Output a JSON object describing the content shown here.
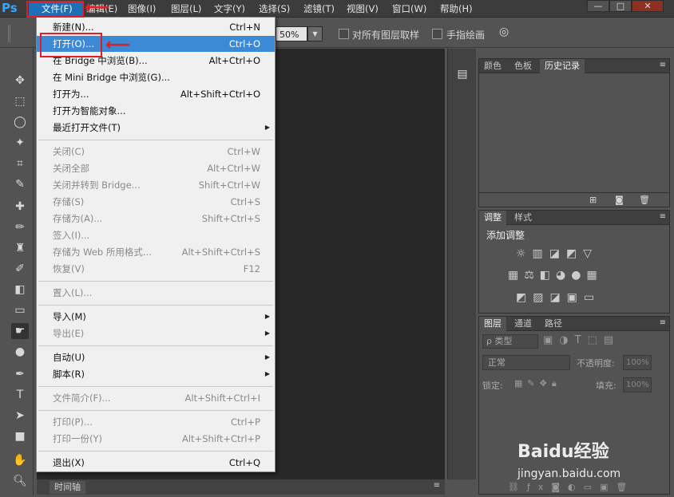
{
  "app": {
    "logo": "Ps"
  },
  "menubar": {
    "items": [
      "文件(F)",
      "编辑(E)",
      "图像(I)",
      "图层(L)",
      "文字(Y)",
      "选择(S)",
      "滤镜(T)",
      "视图(V)",
      "窗口(W)",
      "帮助(H)"
    ]
  },
  "window_controls": {
    "minimize": "—",
    "maximize": "□",
    "close": "✕"
  },
  "options": {
    "zoom": "50%",
    "sample_all_label": "对所有图层取样",
    "finger_paint_label": "手指绘画"
  },
  "file_menu": {
    "items": [
      {
        "label": "新建(N)...",
        "shortcut": "Ctrl+N",
        "enabled": true
      },
      {
        "label": "打开(O)...",
        "shortcut": "Ctrl+O",
        "enabled": true,
        "highlighted": true
      },
      {
        "label": "在 Bridge 中浏览(B)...",
        "shortcut": "Alt+Ctrl+O",
        "enabled": true
      },
      {
        "label": "在 Mini Bridge 中浏览(G)...",
        "shortcut": "",
        "enabled": true
      },
      {
        "label": "打开为...",
        "shortcut": "Alt+Shift+Ctrl+O",
        "enabled": true
      },
      {
        "label": "打开为智能对象...",
        "shortcut": "",
        "enabled": true
      },
      {
        "label": "最近打开文件(T)",
        "shortcut": "",
        "enabled": true,
        "submenu": true
      },
      {
        "separator": true
      },
      {
        "label": "关闭(C)",
        "shortcut": "Ctrl+W",
        "enabled": false
      },
      {
        "label": "关闭全部",
        "shortcut": "Alt+Ctrl+W",
        "enabled": false
      },
      {
        "label": "关闭并转到 Bridge...",
        "shortcut": "Shift+Ctrl+W",
        "enabled": false
      },
      {
        "label": "存储(S)",
        "shortcut": "Ctrl+S",
        "enabled": false
      },
      {
        "label": "存储为(A)...",
        "shortcut": "Shift+Ctrl+S",
        "enabled": false
      },
      {
        "label": "签入(I)...",
        "shortcut": "",
        "enabled": false
      },
      {
        "label": "存储为 Web 所用格式...",
        "shortcut": "Alt+Shift+Ctrl+S",
        "enabled": false
      },
      {
        "label": "恢复(V)",
        "shortcut": "F12",
        "enabled": false
      },
      {
        "separator": true
      },
      {
        "label": "置入(L)...",
        "shortcut": "",
        "enabled": false
      },
      {
        "separator": true
      },
      {
        "label": "导入(M)",
        "shortcut": "",
        "enabled": true,
        "submenu": true
      },
      {
        "label": "导出(E)",
        "shortcut": "",
        "enabled": false,
        "submenu": true
      },
      {
        "separator": true
      },
      {
        "label": "自动(U)",
        "shortcut": "",
        "enabled": true,
        "submenu": true
      },
      {
        "label": "脚本(R)",
        "shortcut": "",
        "enabled": true,
        "submenu": true
      },
      {
        "separator": true
      },
      {
        "label": "文件简介(F)...",
        "shortcut": "Alt+Shift+Ctrl+I",
        "enabled": false
      },
      {
        "separator": true
      },
      {
        "label": "打印(P)...",
        "shortcut": "Ctrl+P",
        "enabled": false
      },
      {
        "label": "打印一份(Y)",
        "shortcut": "Alt+Shift+Ctrl+P",
        "enabled": false
      },
      {
        "separator": true
      },
      {
        "label": "退出(X)",
        "shortcut": "Ctrl+Q",
        "enabled": true
      }
    ]
  },
  "panels": {
    "history": {
      "tabs": [
        "颜色",
        "色板",
        "历史记录"
      ],
      "active": 2
    },
    "adjustments": {
      "tabs": [
        "调整",
        "样式"
      ],
      "active": 0,
      "title": "添加调整"
    },
    "layers": {
      "tabs": [
        "图层",
        "通道",
        "路径"
      ],
      "active": 0,
      "filter_label": "ρ 类型",
      "blend_mode": "正常",
      "opacity_label": "不透明度:",
      "opacity_value": "100%",
      "lock_label": "锁定:",
      "fill_label": "填充:",
      "fill_value": "100%"
    }
  },
  "timeline": {
    "label": "时间轴"
  },
  "watermark": {
    "brand": "Baidu经验",
    "url": "jingyan.baidu.com"
  }
}
